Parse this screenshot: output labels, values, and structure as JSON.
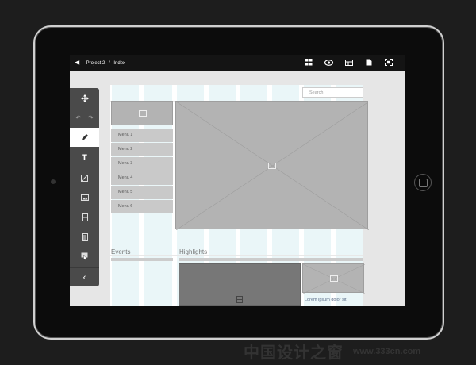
{
  "breadcrumb": {
    "back_icon": "back-arrow-icon",
    "project": "Project 2",
    "separator": "/",
    "page": "Index"
  },
  "topbar_icons": [
    "components-icon",
    "preview-eye-icon",
    "layout-icon",
    "document-icon",
    "fullscreen-icon"
  ],
  "search": {
    "placeholder": "Search"
  },
  "menu": {
    "items": [
      "Menu 1",
      "Menu 2",
      "Menu 3",
      "Menu 4",
      "Menu 5",
      "Menu 6"
    ]
  },
  "sections": {
    "events_title": "Events",
    "highlights_title": "Highlights",
    "lorem": "Lorem ipsum dolor sit"
  },
  "toolbar": {
    "tools": [
      "move-icon",
      "undo-icon",
      "redo-icon",
      "pencil-icon",
      "text-icon",
      "image-placeholder-icon",
      "picture-icon",
      "video-icon",
      "form-icon",
      "widget-icon",
      "collapse-chevron-icon"
    ]
  },
  "watermark": {
    "text": "中国设计之窗",
    "url": "www.333cn.com"
  },
  "colors": {
    "toolbar": "#4a4a4a",
    "topbar": "#141414",
    "wireframe": "#b3b3b3",
    "grid_column": "#d9eff3"
  }
}
